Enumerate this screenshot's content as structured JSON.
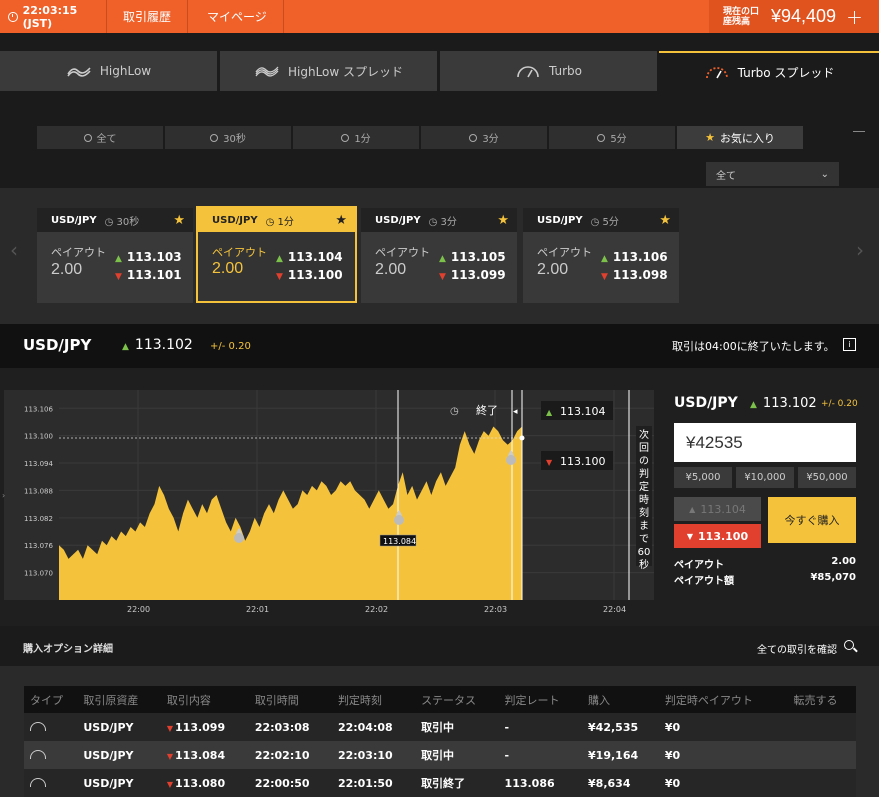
{
  "header": {
    "clock": "22:03:15 (JST)",
    "nav": [
      "取引履歴",
      "マイページ"
    ],
    "balance_label": "現在の口座残高",
    "balance": "¥94,409",
    "plus": "+"
  },
  "product_tabs": [
    "HighLow",
    "HighLow スプレッド",
    "Turbo",
    "Turbo スプレッド"
  ],
  "time_filters": [
    "全て",
    "30秒",
    "1分",
    "3分",
    "5分",
    "お気に入り"
  ],
  "asset_filter": "全て",
  "cards": [
    {
      "pair": "USD/JPY",
      "time": "30秒",
      "payout_label": "ペイアウト",
      "payout": "2.00",
      "high": "113.103",
      "low": "113.101"
    },
    {
      "pair": "USD/JPY",
      "time": "1分",
      "payout_label": "ペイアウト",
      "payout": "2.00",
      "high": "113.104",
      "low": "113.100"
    },
    {
      "pair": "USD/JPY",
      "time": "3分",
      "payout_label": "ペイアウト",
      "payout": "2.00",
      "high": "113.105",
      "low": "113.099"
    },
    {
      "pair": "USD/JPY",
      "time": "5分",
      "payout_label": "ペイアウト",
      "payout": "2.00",
      "high": "113.106",
      "low": "113.098"
    }
  ],
  "pair_bar": {
    "pair": "USD/JPY",
    "rate": "113.102",
    "change": "+/- 0.20",
    "trade_end_msg": "取引は04:00に終了いたします。",
    "info": "i"
  },
  "chart": {
    "end_label": "終了",
    "high_rate": "113.104",
    "low_rate": "113.100",
    "marker_rate": "113.084",
    "countdown": "次回の判定時刻まで60秒",
    "y_ticks": [
      "113.106",
      "113.100",
      "113.094",
      "113.088",
      "113.082",
      "113.076",
      "113.070"
    ],
    "x_ticks": [
      "22:00",
      "22:01",
      "22:02",
      "22:03",
      "22:04"
    ],
    "series": [
      113.076,
      113.075,
      113.073,
      113.074,
      113.075,
      113.073,
      113.076,
      113.075,
      113.074,
      113.077,
      113.076,
      113.078,
      113.077,
      113.079,
      113.078,
      113.08,
      113.079,
      113.081,
      113.08,
      113.083,
      113.085,
      113.089,
      113.087,
      113.084,
      113.082,
      113.079,
      113.083,
      113.086,
      113.084,
      113.082,
      113.085,
      113.083,
      113.086,
      113.087,
      113.084,
      113.081,
      113.079,
      113.082,
      113.08,
      113.077,
      113.079,
      113.082,
      113.08,
      113.083,
      113.085,
      113.083,
      113.086,
      113.088,
      113.086,
      113.084,
      113.085,
      113.088,
      113.087,
      113.089,
      113.088,
      113.09,
      113.089,
      113.087,
      113.088,
      113.09,
      113.089,
      113.09,
      113.088,
      113.087,
      113.086,
      113.084,
      113.086,
      113.088,
      113.086,
      113.084,
      113.085,
      113.089,
      113.092,
      113.087,
      113.089,
      113.086,
      113.088,
      113.09,
      113.087,
      113.09,
      113.092,
      113.089,
      113.091,
      113.093,
      113.098,
      113.101,
      113.098,
      113.096,
      113.099,
      113.101,
      113.1,
      113.102,
      113.101,
      113.099,
      113.098,
      113.099,
      113.101,
      113.102
    ],
    "ymin": 113.064,
    "ymax": 113.11
  },
  "panel": {
    "pair": "USD/JPY",
    "rate": "113.102",
    "change": "+/- 0.20",
    "amount": "¥42535",
    "quick": [
      "¥5,000",
      "¥10,000",
      "¥50,000"
    ],
    "high_btn": "113.104",
    "low_btn": "113.100",
    "buy_btn": "今すぐ購入",
    "payout_label": "ペイアウト",
    "payout": "2.00",
    "payout_amount_label": "ペイアウト額",
    "payout_amount": "¥85,070"
  },
  "details": {
    "title": "購入オプション詳細",
    "link": "全ての取引を確認",
    "columns": [
      "タイプ",
      "取引原資産",
      "取引内容",
      "取引時間",
      "判定時刻",
      "ステータス",
      "判定レート",
      "購入",
      "判定時ペイアウト",
      "転売する"
    ],
    "rows": [
      [
        "",
        "USD/JPY",
        "113.099",
        "22:03:08",
        "22:04:08",
        "取引中",
        "-",
        "¥42,535",
        "¥0",
        ""
      ],
      [
        "",
        "USD/JPY",
        "113.084",
        "22:02:10",
        "22:03:10",
        "取引中",
        "-",
        "¥19,164",
        "¥0",
        ""
      ],
      [
        "",
        "USD/JPY",
        "113.080",
        "22:00:50",
        "22:01:50",
        "取引終了",
        "113.086",
        "¥8,634",
        "¥0",
        ""
      ]
    ]
  }
}
